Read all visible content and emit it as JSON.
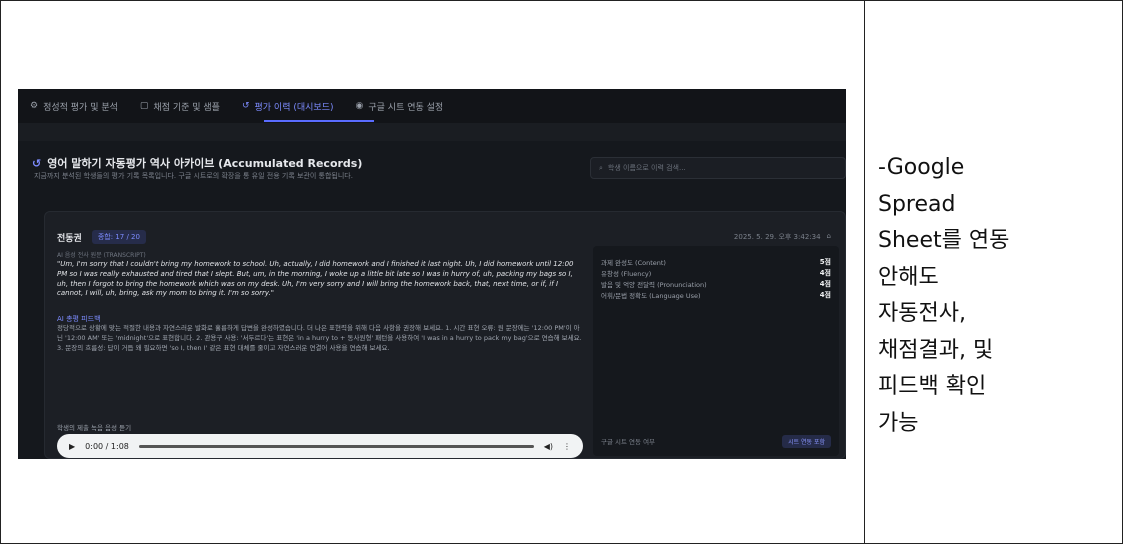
{
  "tabs": [
    {
      "icon": "gear-icon",
      "label": "정성적 평가 및 분석"
    },
    {
      "icon": "book-icon",
      "label": "채점 기준 및 샘플"
    },
    {
      "icon": "history-icon",
      "label": "평가 이력 (대시보드)",
      "active": true
    },
    {
      "icon": "settings-icon",
      "label": "구글 시트 연동 설정"
    }
  ],
  "header": {
    "title": "영어 말하기 자동평가 역사 아카이브 (Accumulated Records)",
    "subtitle": "지금까지 분석된 학생들의 평가 기록 목록입니다. 구글 시트로의 확장을 통 유일 전용 기록 보관이 통합됩니다.",
    "search_placeholder": "학생 이름으로 이력 검색..."
  },
  "record": {
    "student": "전동권",
    "score_badge": "종합: 17 / 20",
    "date": "2025. 5. 29. 오후 3:42:34",
    "transcript_label": "AI 음성 전사 원문 (TRANSCRIPT)",
    "transcript": "\"Um, I'm sorry that I couldn't bring my homework to school. Uh, actually, I did homework and I finished it last night. Uh, I did homework until 12:00 PM so I was really exhausted and tired that I slept. But, um, in the morning, I woke up a little bit late so I was in hurry of, uh, packing my bags so I, uh, then I forgot to bring the homework which was on my desk. Uh, I'm very sorry and I will bring the homework back, that, next time, or if, if I cannot, I will, uh, bring, ask my mom to bring it. I'm so sorry.\"",
    "feedback_label": "AI 총평 피드백",
    "feedback": "정당적으로 상황에 맞는 적절한 내용과 자연스러운 발화로 훌륭하게 답변을 완성하였습니다. 더 나은 표현력을 위해 다음 사항을 권장해 보세요. 1. 시간 표현 오류: 원 문장에는 '12:00 PM'이 아닌 '12:00 AM' 또는 'midnight'으로 표현합니다. 2. 관용구 사용: '서두르다'는 표현은 'in a hurry to + 동사원형' 패턴을 사용하여 'I was in a hurry to pack my bag'으로 연습해 보세요. 3. 문장의 흐름성: 답이 거듭 왜 필요하면 'so I, then I' 같은 표현 대체를 줄이고 자연스러운 연결어 사용을 연습해 보세요.",
    "listen_label": "학생의 제출 녹음 음성 듣기",
    "audio_time": "0:00 / 1:08",
    "scores": [
      {
        "label": "과제 완성도 (Content)",
        "value": "5점"
      },
      {
        "label": "유창성 (Fluency)",
        "value": "4점"
      },
      {
        "label": "발음 및 억양 전달력 (Pronunciation)",
        "value": "4점"
      },
      {
        "label": "어휘/문법 정확도 (Language Use)",
        "value": "4점"
      }
    ],
    "sheet_label": "구글 시트 연동 여부",
    "sheet_button": "시트 연동 포함"
  },
  "description_lines": [
    "-Google",
    "Spread",
    "Sheet를 연동",
    "안해도",
    "자동전사,",
    "채점결과, 및",
    "피드백 확인",
    "가능"
  ]
}
